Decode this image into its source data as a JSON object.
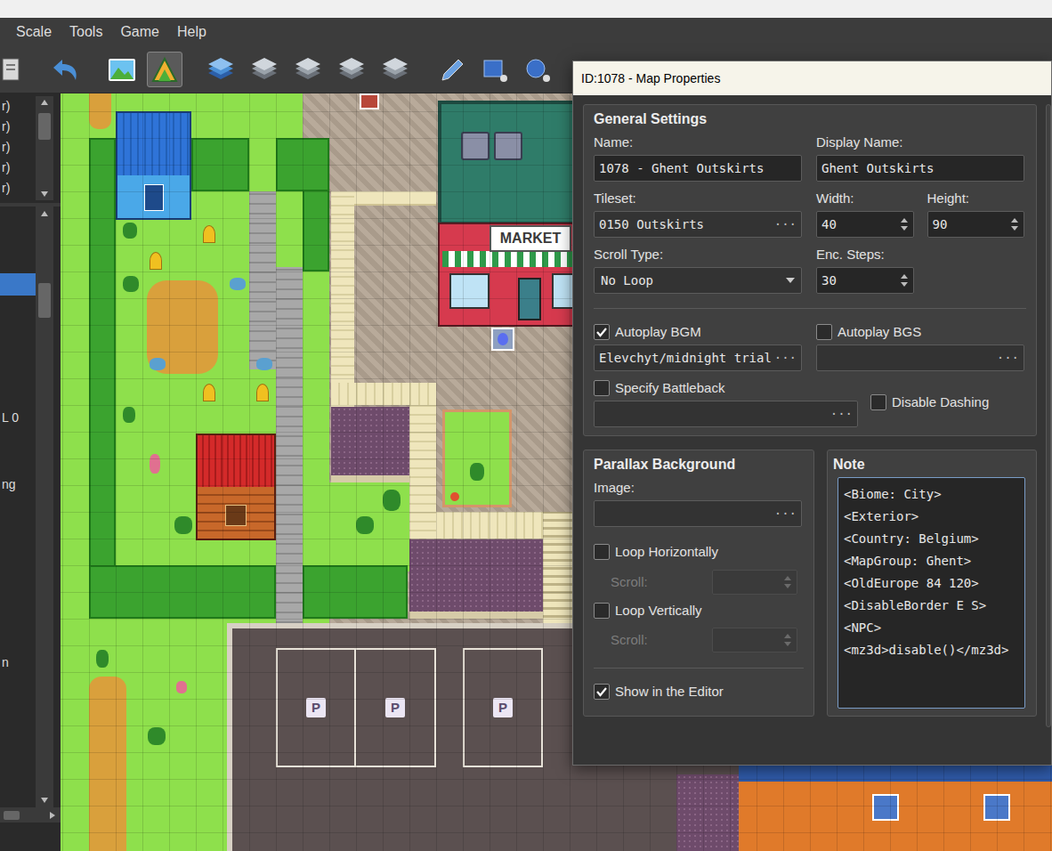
{
  "menu": [
    "Scale",
    "Tools",
    "Game",
    "Help"
  ],
  "toolbar": {
    "buttons": [
      {
        "selected": false
      },
      {
        "selected": false
      },
      {
        "selected": false
      },
      {
        "selected": true
      },
      {
        "selected": false
      },
      {
        "selected": false
      },
      {
        "selected": false
      },
      {
        "selected": false
      },
      {
        "selected": false
      },
      {
        "selected": false
      },
      {
        "selected": false
      },
      {
        "selected": false
      }
    ]
  },
  "left_panel": {
    "top_list": [
      "r)",
      "r)",
      "r)",
      "r)",
      "r)"
    ],
    "tree": [
      {
        "selected": false
      },
      {
        "selected": false
      },
      {
        "selected": false
      },
      {
        "selected": true
      },
      {
        "selected": false
      },
      {
        "selected": false
      },
      {
        "selected": false
      },
      {
        "selected": false
      },
      {
        "selected": false
      },
      {
        "text": "L 0",
        "selected": false
      },
      {
        "selected": false
      },
      {
        "selected": false
      },
      {
        "text": "ng",
        "selected": false
      },
      {
        "selected": false
      },
      {
        "selected": false
      },
      {
        "selected": false
      },
      {
        "selected": false
      },
      {
        "selected": false
      },
      {
        "selected": false
      },
      {
        "selected": false
      },
      {
        "text": "n",
        "selected": false
      },
      {
        "selected": false
      },
      {
        "selected": false
      },
      {
        "selected": false
      },
      {
        "selected": false
      },
      {
        "selected": false
      },
      {
        "selected": false
      }
    ]
  },
  "map": {
    "market_sign": "MARKET",
    "parking_signs": [
      "P",
      "P",
      "P"
    ]
  },
  "dialog": {
    "title": "ID:1078 - Map Properties",
    "general": {
      "heading": "General Settings",
      "name": {
        "label": "Name:",
        "value": "1078 - Ghent Outskirts"
      },
      "display_name": {
        "label": "Display Name:",
        "value": "Ghent Outskirts"
      },
      "tileset": {
        "label": "Tileset:",
        "value": "0150 Outskirts",
        "button": "···"
      },
      "width": {
        "label": "Width:",
        "value": "40"
      },
      "height": {
        "label": "Height:",
        "value": "90"
      },
      "scroll_type": {
        "label": "Scroll Type:",
        "value": "No Loop"
      },
      "enc_steps": {
        "label": "Enc. Steps:",
        "value": "30"
      },
      "autoplay_bgm": {
        "label": "Autoplay BGM",
        "checked": true,
        "value": "Elevchyt/midnight trial",
        "button": "···"
      },
      "autoplay_bgs": {
        "label": "Autoplay BGS",
        "checked": false,
        "button": "···"
      },
      "battleback": {
        "label": "Specify Battleback",
        "checked": false,
        "button": "···"
      },
      "disable_dashing": {
        "label": "Disable Dashing",
        "checked": false
      }
    },
    "parallax": {
      "heading": "Parallax Background",
      "image_label": "Image:",
      "image_button": "···",
      "loop_h": {
        "label": "Loop Horizontally",
        "checked": false
      },
      "scroll_h": {
        "label": "Scroll:",
        "disabled": true
      },
      "loop_v": {
        "label": "Loop Vertically",
        "checked": false
      },
      "scroll_v": {
        "label": "Scroll:",
        "disabled": true
      },
      "show_in_editor": {
        "label": "Show in the Editor",
        "checked": true
      }
    },
    "note": {
      "heading": "Note",
      "lines": [
        "<Biome: City>",
        "<Exterior>",
        "<Country: Belgium>",
        "<MapGroup: Ghent>",
        "<OldEurope 84 120>",
        "<DisableBorder E S>",
        "<NPC>",
        "<mz3d>disable()</mz3d>"
      ]
    }
  }
}
